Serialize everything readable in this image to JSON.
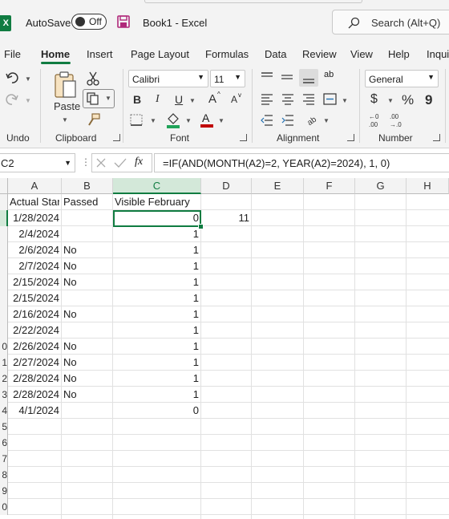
{
  "titlebar": {
    "app_logo": "X",
    "autosave_label": "AutoSave",
    "autosave_state": "Off",
    "doc_title": "Book1  -  Excel",
    "search_placeholder": "Search (Alt+Q)"
  },
  "menu": {
    "tabs": [
      "File",
      "Home",
      "Insert",
      "Page Layout",
      "Formulas",
      "Data",
      "Review",
      "View",
      "Help",
      "Inqui"
    ],
    "active_tab": "Home"
  },
  "ribbon": {
    "groups": {
      "undo": "Undo",
      "clipboard": "Clipboard",
      "font": "Font",
      "alignment": "Alignment",
      "number": "Number"
    },
    "paste_label": "Paste",
    "font_name": "Calibri",
    "font_size": "11",
    "number_format": "General",
    "bold": "B",
    "italic": "I",
    "underline": "U",
    "grow_font": "A",
    "shrink_font": "A",
    "currency": "$",
    "percent": "%",
    "comma": "9",
    "wrap": "ab"
  },
  "formula_bar": {
    "name_box": "C2",
    "fx": "fx",
    "formula": "=IF(AND(MONTH(A2)=2, YEAR(A2)=2024), 1, 0)"
  },
  "sheet": {
    "columns": [
      "A",
      "B",
      "C",
      "D",
      "E",
      "F",
      "G",
      "H"
    ],
    "selected_column": "C",
    "row_numbers": [
      "",
      "",
      "",
      "",
      "",
      "",
      "",
      "",
      "",
      "0",
      "1",
      "2",
      "3",
      "4",
      "5",
      "6",
      "7",
      "8",
      "9",
      "0"
    ],
    "header_row": {
      "A": "Actual Star",
      "B": "Passed",
      "C": "Visible February"
    },
    "rows": [
      {
        "A": "1/28/2024",
        "B": "",
        "C": "0",
        "D": "11"
      },
      {
        "A": "2/4/2024",
        "B": "",
        "C": "1",
        "D": ""
      },
      {
        "A": "2/6/2024",
        "B": "No",
        "C": "1",
        "D": ""
      },
      {
        "A": "2/7/2024",
        "B": "No",
        "C": "1",
        "D": ""
      },
      {
        "A": "2/15/2024",
        "B": "No",
        "C": "1",
        "D": ""
      },
      {
        "A": "2/15/2024",
        "B": "",
        "C": "1",
        "D": ""
      },
      {
        "A": "2/16/2024",
        "B": "No",
        "C": "1",
        "D": ""
      },
      {
        "A": "2/22/2024",
        "B": "",
        "C": "1",
        "D": ""
      },
      {
        "A": "2/26/2024",
        "B": "No",
        "C": "1",
        "D": ""
      },
      {
        "A": "2/27/2024",
        "B": "No",
        "C": "1",
        "D": ""
      },
      {
        "A": "2/28/2024",
        "B": "No",
        "C": "1",
        "D": ""
      },
      {
        "A": "2/28/2024",
        "B": "No",
        "C": "1",
        "D": ""
      },
      {
        "A": "4/1/2024",
        "B": "",
        "C": "0",
        "D": ""
      }
    ]
  },
  "colors": {
    "accent": "#107c41",
    "selected_header_bg": "#d3e8d9"
  }
}
